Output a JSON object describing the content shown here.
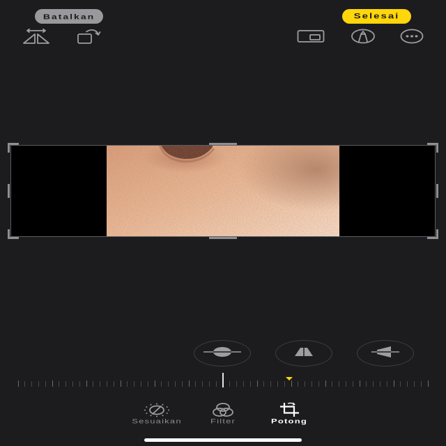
{
  "header": {
    "cancel_label": "Batalkan",
    "done_label": "Selesai"
  },
  "toolbar": {
    "left_icons": [
      "flip-horizontal-icon",
      "rotate-icon"
    ],
    "right_icons": [
      "aspect-ratio-icon",
      "markup-icon",
      "more-icon"
    ]
  },
  "adjust_buttons": [
    {
      "icon": "straighten-icon"
    },
    {
      "icon": "vertical-perspective-icon"
    },
    {
      "icon": "horizontal-perspective-icon"
    }
  ],
  "tabs": [
    {
      "label": "Sesuaikan",
      "icon": "adjust-dial-icon",
      "active": false
    },
    {
      "label": "Filter",
      "icon": "filter-icon",
      "active": false
    },
    {
      "label": "Potong",
      "icon": "crop-icon",
      "active": true
    }
  ],
  "colors": {
    "background": "#1c1c1e",
    "accent": "#ffd60a",
    "cancel_button": "#98989d",
    "inactive": "#8e8e93",
    "active": "#ffffff"
  }
}
